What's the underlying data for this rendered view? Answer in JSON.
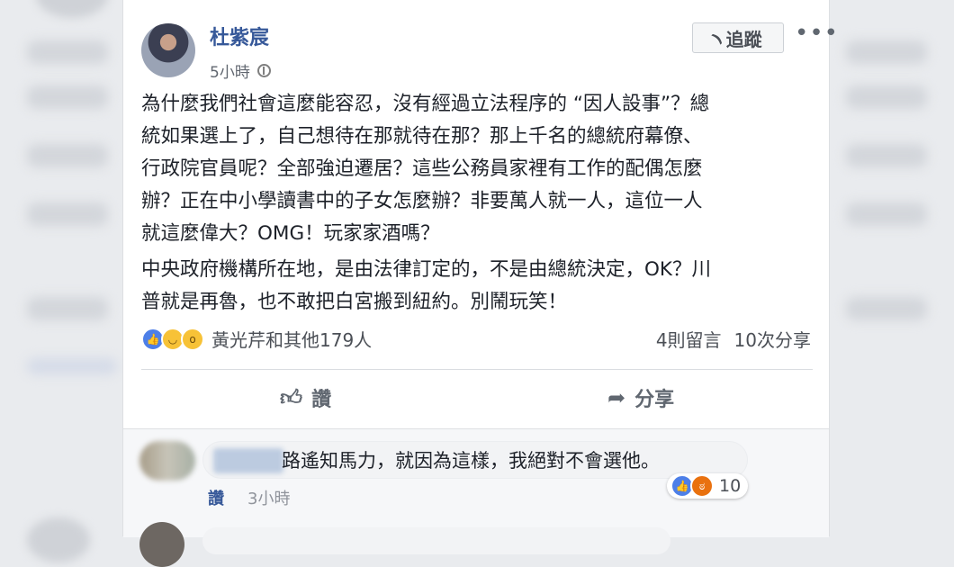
{
  "post": {
    "author": "杜紫宸",
    "time": "5小時",
    "follow_label": "追蹤",
    "more_label": "•••",
    "paragraph1": "為什麼我們社會這麼能容忍，沒有經過立法程序的 “因人設事”？總\n統如果選上了，自己想待在那就待在那？那上千名的總統府幕僚、\n行政院官員呢？全部強迫遷居？這些公務員家裡有工作的配偶怎麼\n辦？正在中小學讀書中的子女怎麼辦？非要萬人就一人，這位一人\n就這麼偉大？OMG！玩家家酒嗎？",
    "paragraph2": "中央政府機構所在地，是由法律訂定的，不是由總統決定，OK？川\n普就是再魯，也不敢把白宮搬到紐約。別鬧玩笑！",
    "reactions_text": "黃光芹和其他179人",
    "comments_count": "4則留言",
    "shares_count": "10次分享"
  },
  "actions": {
    "like_label": "讚",
    "share_label": "分享"
  },
  "comment": {
    "text": "路遙知馬力，就因為這樣，我絕對不會選他。",
    "like_label": "讚",
    "time": "3小時",
    "reaction_count": "10"
  },
  "icons": {
    "globe": "globe-icon",
    "rss": "rss-icon",
    "thumbs_up": "thumbs-up-icon",
    "share": "share-arrow-icon"
  },
  "colors": {
    "link_blue": "#365899",
    "text": "#1d2129",
    "secondary": "#606770",
    "like_blue": "#4d7fe8",
    "angry_orange": "#e9710f"
  }
}
